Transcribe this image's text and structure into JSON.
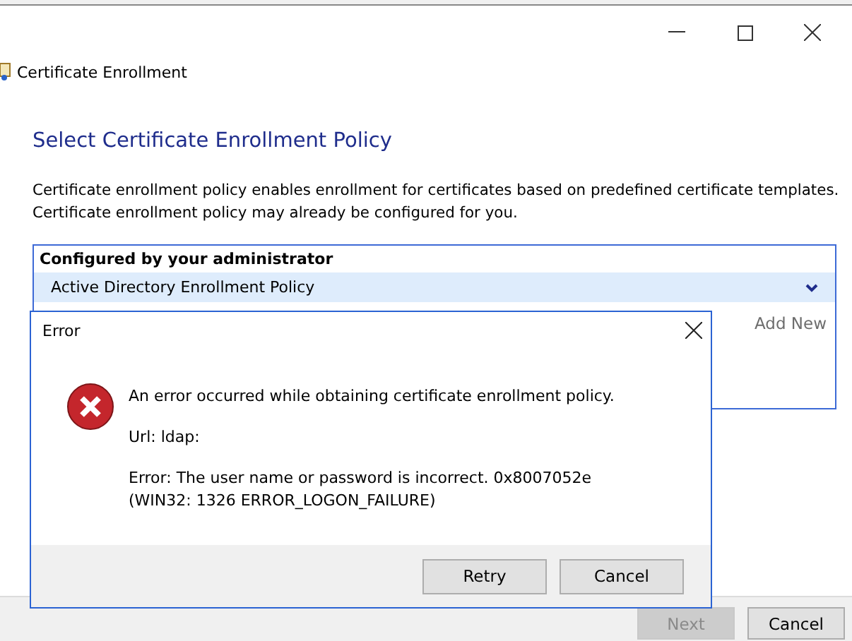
{
  "window": {
    "title": "Certificate Enrollment"
  },
  "heading": "Select Certificate Enrollment Policy",
  "description": [
    "Certificate enrollment policy enables enrollment for certificates based on predefined certificate templates.",
    "Certificate enrollment policy may already be configured for you."
  ],
  "policy_box": {
    "header": "Configured by your administrator",
    "policies": [
      {
        "name": "Active Directory Enrollment Policy",
        "selected": true
      }
    ],
    "add_new": "Add New"
  },
  "footer_buttons": [
    {
      "label": "Next",
      "disabled": true
    },
    {
      "label": "Cancel",
      "disabled": false
    }
  ],
  "error_dialog": {
    "title": "Error",
    "messages": [
      "An error occurred while obtaining certificate enrollment policy.",
      "Url: ldap:",
      "Error: The user name or password is incorrect. 0x8007052e (WIN32: 1326 ERROR_LOGON_FAILURE)"
    ],
    "buttons": [
      "Retry",
      "Cancel"
    ]
  }
}
